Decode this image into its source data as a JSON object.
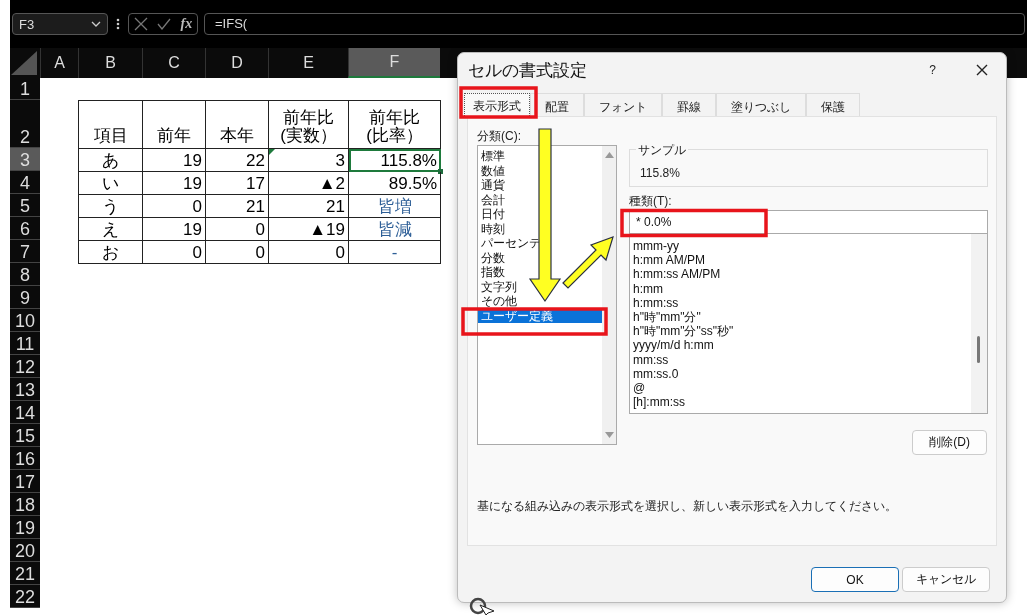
{
  "formula_bar": {
    "name_box": "F3",
    "fx": "fx",
    "formula": "=IFS("
  },
  "columns": [
    {
      "label": "A",
      "selected": false
    },
    {
      "label": "B",
      "selected": false
    },
    {
      "label": "C",
      "selected": false
    },
    {
      "label": "D",
      "selected": false
    },
    {
      "label": "E",
      "selected": false
    },
    {
      "label": "F",
      "selected": true
    }
  ],
  "row_numbers": [
    {
      "label": "1",
      "selected": false
    },
    {
      "label": "2",
      "selected": false
    },
    {
      "label": "3",
      "selected": true
    },
    {
      "label": "4",
      "selected": false
    },
    {
      "label": "5",
      "selected": false
    },
    {
      "label": "6",
      "selected": false
    },
    {
      "label": "7",
      "selected": false
    },
    {
      "label": "8",
      "selected": false
    },
    {
      "label": "9",
      "selected": false
    },
    {
      "label": "10",
      "selected": false
    },
    {
      "label": "11",
      "selected": false
    },
    {
      "label": "12",
      "selected": false
    },
    {
      "label": "13",
      "selected": false
    },
    {
      "label": "14",
      "selected": false
    },
    {
      "label": "15",
      "selected": false
    },
    {
      "label": "16",
      "selected": false
    },
    {
      "label": "17",
      "selected": false
    },
    {
      "label": "18",
      "selected": false
    },
    {
      "label": "19",
      "selected": false
    },
    {
      "label": "20",
      "selected": false
    },
    {
      "label": "21",
      "selected": false
    },
    {
      "label": "22",
      "selected": false
    }
  ],
  "table": {
    "header": [
      "項目",
      "前年",
      "本年",
      "前年比\n(実数）",
      "前年比\n(比率）"
    ],
    "rows": [
      {
        "cells": [
          {
            "text": "あ",
            "kind": "label",
            "selected": false,
            "warning": false
          },
          {
            "text": "19",
            "kind": "number",
            "selected": false,
            "warning": false
          },
          {
            "text": "22",
            "kind": "number",
            "selected": false,
            "warning": false
          },
          {
            "text": "3",
            "kind": "number",
            "selected": false,
            "warning": true
          },
          {
            "text": "115.8%",
            "kind": "number",
            "selected": true,
            "warning": false
          }
        ]
      },
      {
        "cells": [
          {
            "text": "い",
            "kind": "label",
            "selected": false,
            "warning": false
          },
          {
            "text": "19",
            "kind": "number",
            "selected": false,
            "warning": false
          },
          {
            "text": "17",
            "kind": "number",
            "selected": false,
            "warning": false
          },
          {
            "text": "▲2",
            "kind": "number",
            "selected": false,
            "warning": false
          },
          {
            "text": "89.5%",
            "kind": "number",
            "selected": false,
            "warning": false
          }
        ]
      },
      {
        "cells": [
          {
            "text": "う",
            "kind": "label",
            "selected": false,
            "warning": false
          },
          {
            "text": "0",
            "kind": "number",
            "selected": false,
            "warning": false
          },
          {
            "text": "21",
            "kind": "number",
            "selected": false,
            "warning": false
          },
          {
            "text": "21",
            "kind": "number",
            "selected": false,
            "warning": false
          },
          {
            "text": "皆増",
            "kind": "status",
            "selected": false,
            "warning": false
          }
        ]
      },
      {
        "cells": [
          {
            "text": "え",
            "kind": "label",
            "selected": false,
            "warning": false
          },
          {
            "text": "19",
            "kind": "number",
            "selected": false,
            "warning": false
          },
          {
            "text": "0",
            "kind": "number",
            "selected": false,
            "warning": false
          },
          {
            "text": "▲19",
            "kind": "number",
            "selected": false,
            "warning": false
          },
          {
            "text": "皆減",
            "kind": "status",
            "selected": false,
            "warning": false
          }
        ]
      },
      {
        "cells": [
          {
            "text": "お",
            "kind": "label",
            "selected": false,
            "warning": false
          },
          {
            "text": "0",
            "kind": "number",
            "selected": false,
            "warning": false
          },
          {
            "text": "0",
            "kind": "number",
            "selected": false,
            "warning": false
          },
          {
            "text": "0",
            "kind": "number",
            "selected": false,
            "warning": false
          },
          {
            "text": "-",
            "kind": "status",
            "selected": false,
            "warning": false
          }
        ]
      }
    ]
  },
  "dialog": {
    "title": "セルの書式設定",
    "help": "?",
    "tabs": [
      {
        "label": "表示形式",
        "selected": true
      },
      {
        "label": "配置",
        "selected": false
      },
      {
        "label": "フォント",
        "selected": false
      },
      {
        "label": "罫線",
        "selected": false
      },
      {
        "label": "塗りつぶし",
        "selected": false
      },
      {
        "label": "保護",
        "selected": false
      }
    ],
    "category_label": "分類(C):",
    "categories": [
      {
        "label": "標準",
        "selected": false
      },
      {
        "label": "数値",
        "selected": false
      },
      {
        "label": "通貨",
        "selected": false
      },
      {
        "label": "会計",
        "selected": false
      },
      {
        "label": "日付",
        "selected": false
      },
      {
        "label": "時刻",
        "selected": false
      },
      {
        "label": "パーセンテ",
        "selected": false
      },
      {
        "label": "分数",
        "selected": false
      },
      {
        "label": "指数",
        "selected": false
      },
      {
        "label": "文字列",
        "selected": false
      },
      {
        "label": "その他",
        "selected": false
      },
      {
        "label": "ユーザー定義",
        "selected": true
      }
    ],
    "sample_label": "サンプル",
    "sample_value": "115.8%",
    "type_label": "種類(T):",
    "type_value": "* 0.0%",
    "formats": [
      "mmm-yy",
      "h:mm AM/PM",
      "h:mm:ss AM/PM",
      "h:mm",
      "h:mm:ss",
      "h\"時\"mm\"分\"",
      "h\"時\"mm\"分\"ss\"秒\"",
      "yyyy/m/d h:mm",
      "mm:ss",
      "mm:ss.0",
      "@",
      "[h]:mm:ss"
    ],
    "delete_button": "削除(D)",
    "description": "基になる組み込みの表示形式を選択し、新しい表示形式を入力してください。",
    "buttons": [
      {
        "label": "OK",
        "default": true
      },
      {
        "label": "キャンセル",
        "default": false
      }
    ]
  }
}
